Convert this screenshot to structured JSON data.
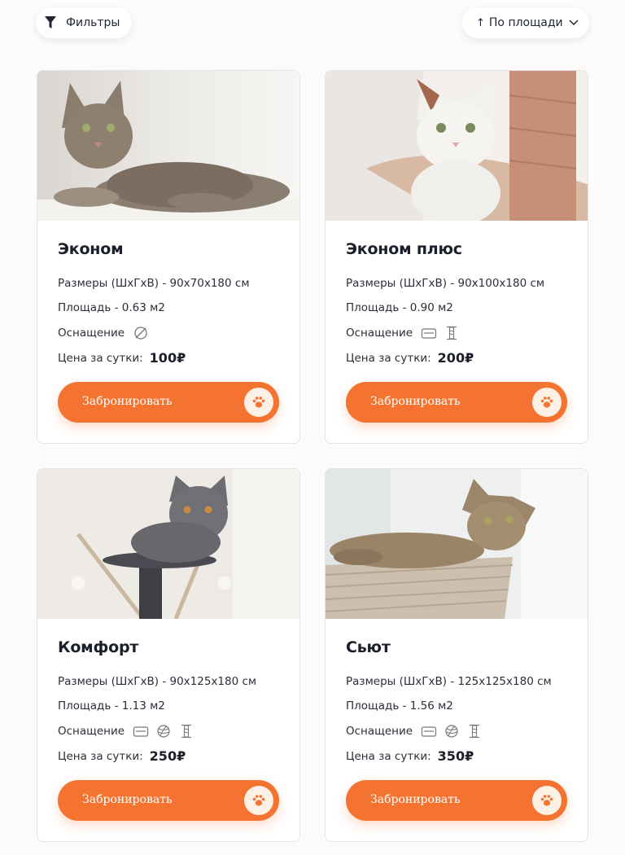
{
  "toolbar": {
    "filter_label": "Фильтры",
    "filter_icon": "funnel-icon",
    "sort_arrow": "↑",
    "sort_label": "По площади",
    "sort_icon": "chevron-down-icon"
  },
  "labels": {
    "size": "Размеры (ШхГхВ) - ",
    "area": "Площадь - ",
    "equipment": "Оснащение",
    "price": "Цена за сутки:",
    "book": "Забронировать"
  },
  "colors": {
    "accent": "#f47330",
    "paw_bg": "#fdf0e4"
  },
  "rooms": [
    {
      "name": "Эконом",
      "size": "Размеры (ШхГхВ) - 90x70x180 см",
      "area": "Площадь - 0.63 м2",
      "equipment": [
        "none-icon"
      ],
      "price": "100₽",
      "photo": "grey tabby cat lying on white cushion"
    },
    {
      "name": "Эконом плюс",
      "size": "Размеры (ШхГхВ) - 90x100x180 см",
      "area": "Площадь - 0.90 м2",
      "equipment": [
        "bed-icon",
        "scratching-post-icon"
      ],
      "price": "200₽",
      "photo": "white calico cat on scratching post"
    },
    {
      "name": "Комфорт",
      "size": "Размеры (ШхГхВ) - 90x125x180 см",
      "area": "Площадь - 1.13 м2",
      "equipment": [
        "bed-icon",
        "yarn-ball-icon",
        "scratching-post-icon"
      ],
      "price": "250₽",
      "photo": "grey British cat on cat tree"
    },
    {
      "name": "Сьют",
      "size": "Размеры (ШхГхВ) - 125x125x180 см",
      "area": "Площадь - 1.56 м2",
      "equipment": [
        "bed-icon",
        "yarn-ball-icon",
        "scratching-post-icon"
      ],
      "price": "350₽",
      "photo": "tabby cat in wicker basket"
    }
  ]
}
